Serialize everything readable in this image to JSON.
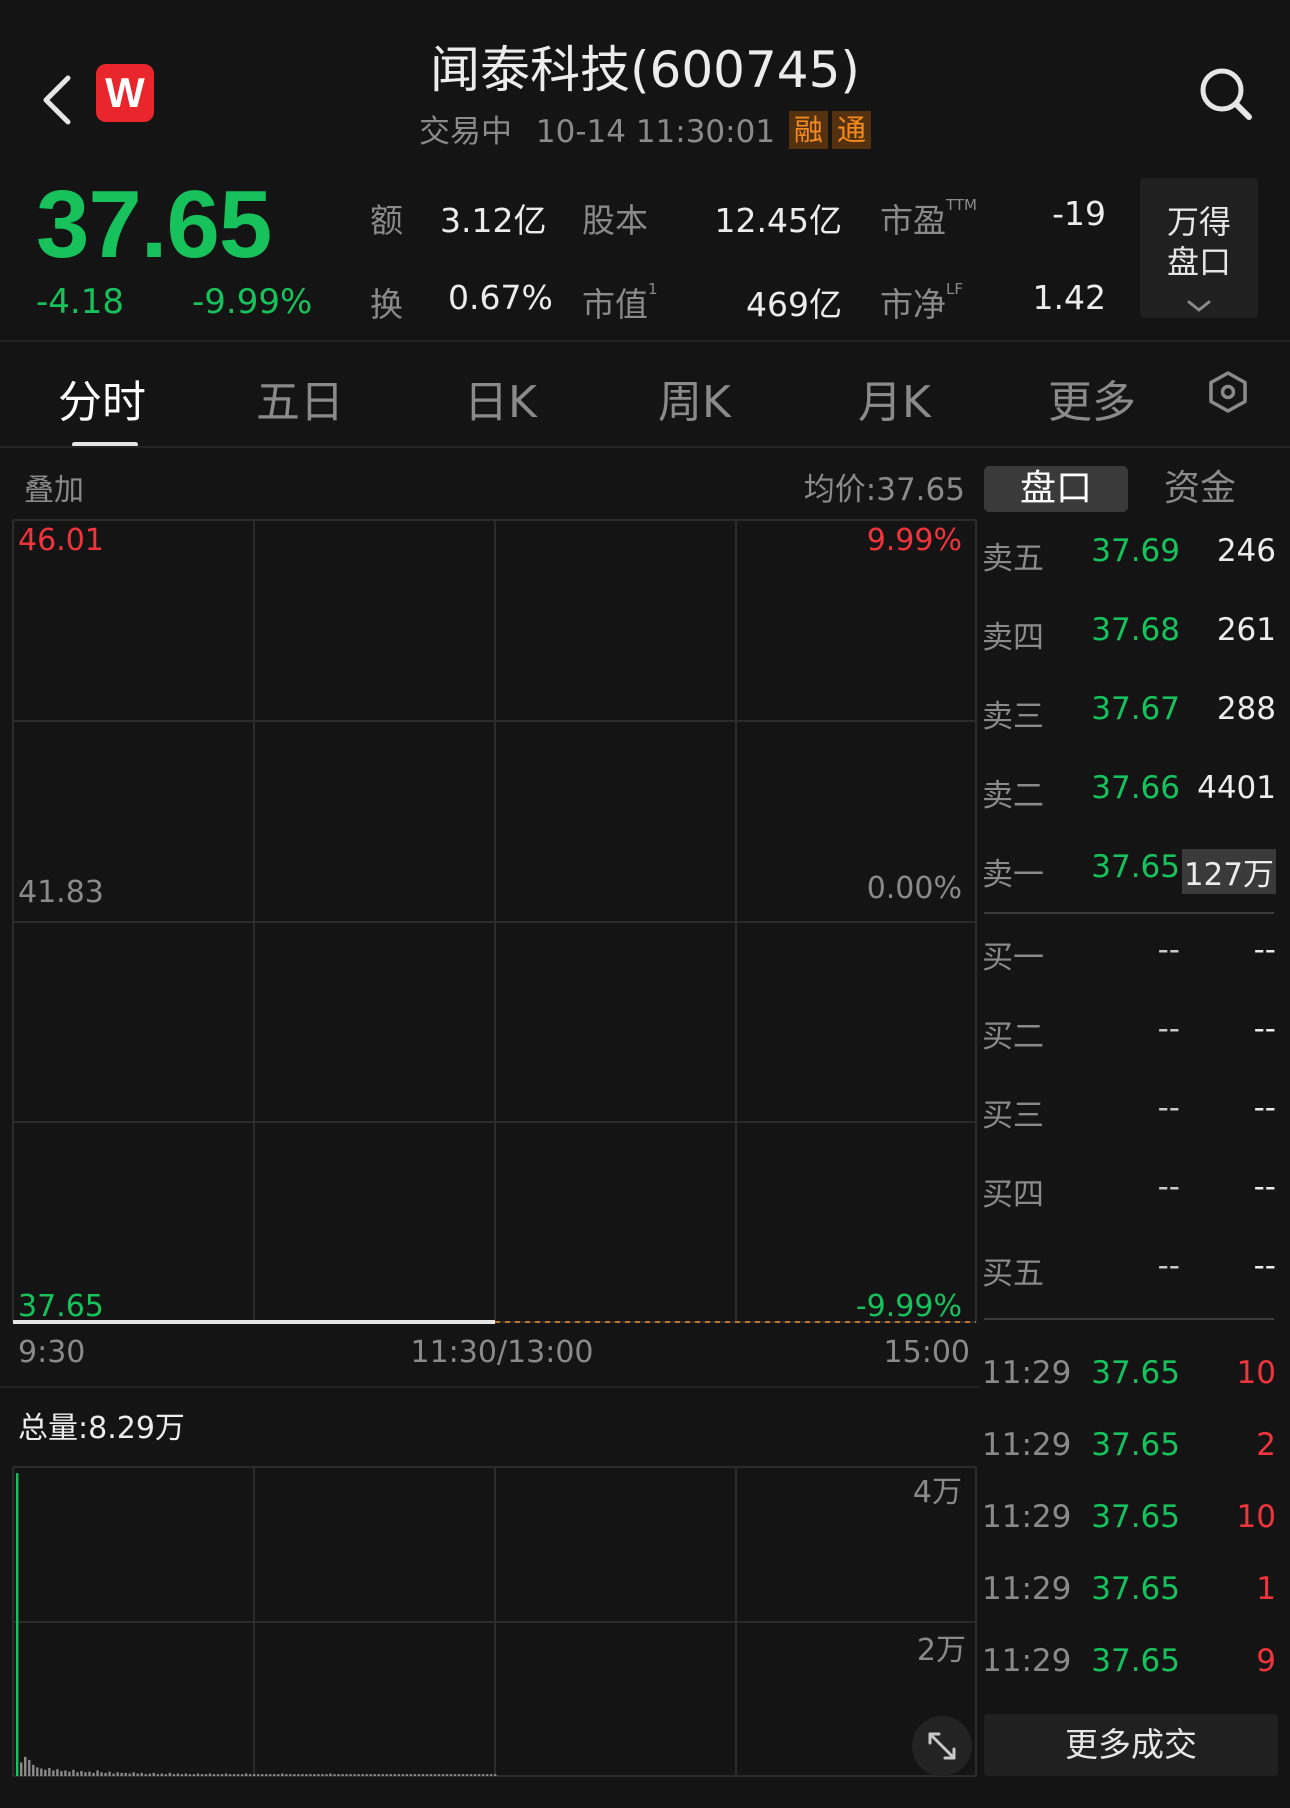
{
  "header": {
    "title": "闻泰科技(600745)",
    "status": "交易中",
    "datetime": "10-14 11:30:01",
    "tags": [
      "融",
      "通"
    ],
    "logo_letter": "W"
  },
  "quote": {
    "price": "37.65",
    "change": "-4.18",
    "change_pct": "-9.99%",
    "stats": [
      {
        "label": "额",
        "value": "3.12亿"
      },
      {
        "label": "股本",
        "value": "12.45亿"
      },
      {
        "label": "市盈",
        "sup": "TTM",
        "value": "-19"
      },
      {
        "label": "换",
        "value": "0.67%"
      },
      {
        "label": "市值",
        "sup": "1",
        "value": "469亿"
      },
      {
        "label": "市净",
        "sup": "LF",
        "value": "1.42"
      }
    ],
    "wind_button": [
      "万得",
      "盘口"
    ]
  },
  "tabs": [
    "分时",
    "五日",
    "日K",
    "周K",
    "月K",
    "更多"
  ],
  "chart": {
    "overlay_label": "叠加",
    "avg_price": "均价:37.65",
    "price_high": "46.01",
    "price_mid": "41.83",
    "price_low": "37.65",
    "pct_high": "9.99%",
    "pct_mid": "0.00%",
    "pct_low": "-9.99%",
    "time_start": "9:30",
    "time_mid": "11:30/13:00",
    "time_end": "15:00",
    "volume_total": "总量:8.29万",
    "vol_tick_high": "4万",
    "vol_tick_mid": "2万"
  },
  "chart_data": {
    "type": "line",
    "title": "",
    "xlabel": "",
    "ylabel": "",
    "x_ticks": [
      "9:30",
      "11:30/13:00",
      "15:00"
    ],
    "y_ticks": [
      "46.01",
      "41.83",
      "37.65"
    ],
    "y_pct_ticks": [
      "9.99%",
      "0.00%",
      "-9.99%"
    ],
    "ylim": [
      37.65,
      46.01
    ],
    "series": [
      {
        "values_description_free": true,
        "start": "9:30",
        "end": "11:30",
        "value": 37.65
      }
    ],
    "volume": {
      "ylim": [
        0,
        50000
      ],
      "y_ticks": [
        "4万",
        "2万"
      ],
      "values": [
        49000,
        2200,
        3100,
        2600,
        1800,
        1400,
        1200,
        1000,
        1300,
        900,
        1100,
        800,
        900,
        700,
        1000,
        600,
        800,
        600,
        700,
        500,
        900,
        600,
        500,
        700,
        400,
        600,
        500,
        500,
        400,
        600,
        400,
        500,
        300,
        400,
        500,
        300,
        400,
        300,
        500,
        300,
        400,
        300,
        400,
        300,
        300,
        400,
        300,
        300,
        400,
        300,
        300,
        300,
        400,
        300,
        300,
        300,
        300,
        400,
        300,
        300,
        300,
        300,
        300,
        300,
        300,
        300,
        400,
        300,
        300,
        300,
        300,
        300,
        300,
        300,
        300,
        300,
        300,
        300,
        400,
        300,
        300,
        300,
        300,
        300,
        300,
        300,
        300,
        300,
        300,
        300,
        300,
        300,
        300,
        300,
        300,
        300,
        300,
        300,
        300,
        300,
        300,
        300,
        300,
        300,
        300,
        300,
        300,
        300,
        300,
        300,
        300,
        300,
        300,
        300,
        300,
        300,
        300,
        300,
        300,
        300
      ]
    }
  },
  "orderbook": {
    "toggle": [
      "盘口",
      "资金"
    ],
    "asks": [
      {
        "name": "卖五",
        "price": "37.69",
        "vol": "246"
      },
      {
        "name": "卖四",
        "price": "37.68",
        "vol": "261"
      },
      {
        "name": "卖三",
        "price": "37.67",
        "vol": "288"
      },
      {
        "name": "卖二",
        "price": "37.66",
        "vol": "4401"
      },
      {
        "name": "卖一",
        "price": "37.65",
        "vol": "127万"
      }
    ],
    "bids": [
      {
        "name": "买一",
        "price": "--",
        "vol": "--"
      },
      {
        "name": "买二",
        "price": "--",
        "vol": "--"
      },
      {
        "name": "买三",
        "price": "--",
        "vol": "--"
      },
      {
        "name": "买四",
        "price": "--",
        "vol": "--"
      },
      {
        "name": "买五",
        "price": "--",
        "vol": "--"
      }
    ],
    "trades": [
      {
        "time": "11:29",
        "price": "37.65",
        "vol": "10"
      },
      {
        "time": "11:29",
        "price": "37.65",
        "vol": "2"
      },
      {
        "time": "11:29",
        "price": "37.65",
        "vol": "10"
      },
      {
        "time": "11:29",
        "price": "37.65",
        "vol": "1"
      },
      {
        "time": "11:29",
        "price": "37.65",
        "vol": "9"
      }
    ],
    "more_trades": "更多成交"
  },
  "colors": {
    "up": "#f0343c",
    "down": "#17c15b",
    "background": "#141414",
    "accent": "#f58a1f"
  }
}
